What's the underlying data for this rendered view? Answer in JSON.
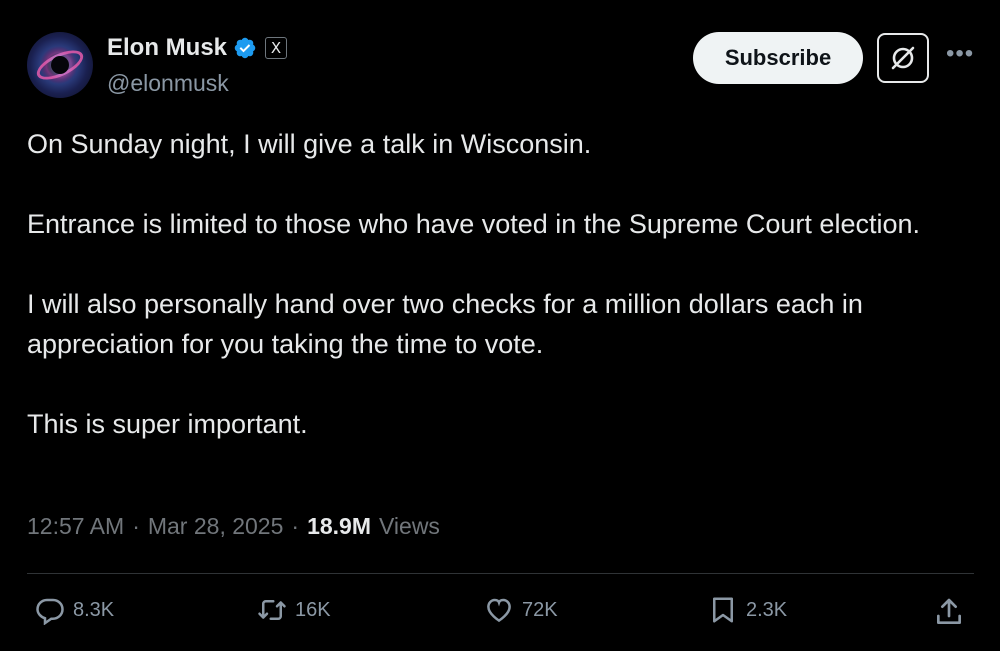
{
  "author": {
    "name": "Elon Musk",
    "handle": "@elonmusk",
    "verified": true,
    "affiliate_badge": "X"
  },
  "header": {
    "subscribe_label": "Subscribe",
    "grok_icon": "grok-icon",
    "more_icon": "more-dots-icon"
  },
  "tweet": {
    "paragraphs": [
      "On Sunday night, I will give a talk in Wisconsin.",
      "Entrance is limited to those who have voted in the Supreme Court election.",
      "I will also personally hand over two checks for a million dollars each in appreciation for you taking the time to vote.",
      "This is super important."
    ],
    "time": "12:57 AM",
    "date": "Mar 28, 2025",
    "views_count": "18.9M",
    "views_label": "Views"
  },
  "actions": {
    "replies": "8.3K",
    "reposts": "16K",
    "likes": "72K",
    "bookmarks": "2.3K"
  },
  "colors": {
    "background": "#000000",
    "text": "#e7e9ea",
    "muted": "#71767b",
    "verified_blue": "#1d9bf0",
    "divider": "#2f3336"
  }
}
